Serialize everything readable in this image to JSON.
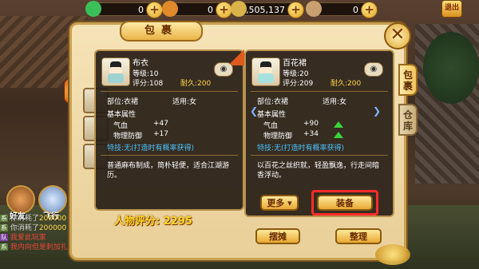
{
  "resources": [
    {
      "name": "jade",
      "value": "0",
      "color": "#3bbf5a"
    },
    {
      "name": "gold-ingot",
      "value": "0",
      "color": "#e08a2a"
    },
    {
      "name": "coins",
      "value": "1,505,137",
      "color": "#d8b24a"
    },
    {
      "name": "silver",
      "value": "0",
      "color": "#c9a070"
    }
  ],
  "exit_label": "退出",
  "panel": {
    "title": "包裹",
    "close_label": "✕"
  },
  "side_tabs": [
    {
      "label": "包裹",
      "active": true
    },
    {
      "label": "仓库",
      "active": false
    }
  ],
  "left_item": {
    "name": "布衣",
    "level": "等级:10",
    "score": "评分:108",
    "durability": "耐久:200",
    "slot": "部位:衣裙",
    "gender": "适用:女",
    "attr_header": "基本属性",
    "attrs": [
      {
        "name": "气血",
        "value": "+47"
      },
      {
        "name": "物理防御",
        "value": "+17"
      }
    ],
    "trait": "特技:无(打造时有概率获得)",
    "description": "普通麻布制成，简朴轻便，适合江湖游历。"
  },
  "right_item": {
    "name": "百花裙",
    "level": "等级:20",
    "score": "评分:209",
    "durability": "耐久:200",
    "slot": "部位:衣裙",
    "gender": "适用:女",
    "attr_header": "基本属性",
    "attrs": [
      {
        "name": "气血",
        "value": "+90"
      },
      {
        "name": "物理防御",
        "value": "+34"
      }
    ],
    "trait": "特技:无(打造时有概率获得)",
    "description": "以百花之丝织就，轻盈飘逸，行走间暗香浮动。"
  },
  "buttons": {
    "more": "更多",
    "equip": "装备",
    "stall": "摆摊",
    "sort": "整理"
  },
  "character_score": "人物评分: 2295",
  "left_hud": {
    "friends": "好友",
    "fly": "飞行"
  },
  "chat": [
    {
      "tag": "系",
      "text": "你消耗了",
      "num": "200000"
    },
    {
      "tag": "系",
      "text": "你消耗了",
      "num": "200000"
    },
    {
      "tag": "队",
      "text": "我爱此玩家",
      "num": ""
    },
    {
      "tag": "系",
      "text": "我内向但是刺加扎",
      "num": ""
    }
  ]
}
